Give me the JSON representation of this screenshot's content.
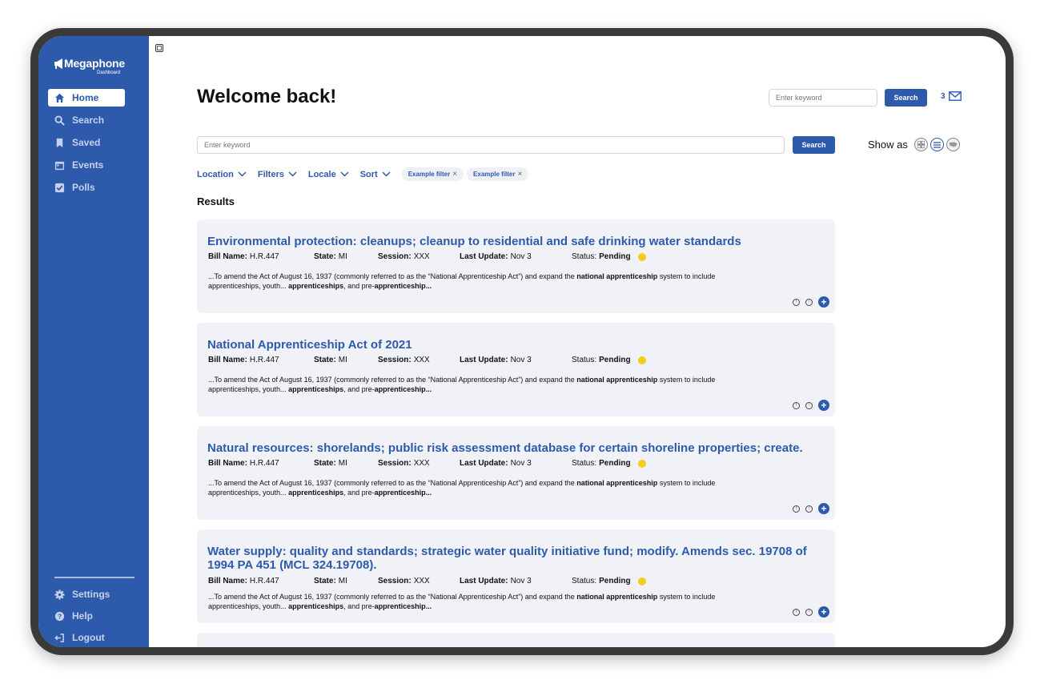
{
  "brand": {
    "name": "Megaphone",
    "subtitle": "Dashboard"
  },
  "sidebar": {
    "items": [
      {
        "label": "Home",
        "icon": "home-icon",
        "active": true
      },
      {
        "label": "Search",
        "icon": "search-icon"
      },
      {
        "label": "Saved",
        "icon": "bookmark-icon"
      },
      {
        "label": "Events",
        "icon": "calendar-icon"
      },
      {
        "label": "Polls",
        "icon": "checkbox-icon"
      }
    ],
    "bottom": [
      {
        "label": "Settings",
        "icon": "gear-icon"
      },
      {
        "label": "Help",
        "icon": "help-icon"
      },
      {
        "label": "Logout",
        "icon": "logout-icon"
      }
    ]
  },
  "header": {
    "title": "Welcome back!",
    "search_placeholder": "Enter keyword",
    "search_button": "Search",
    "message_count": "3"
  },
  "main_search": {
    "placeholder": "Enter keyword",
    "button": "Search"
  },
  "view": {
    "label": "Show as",
    "options": [
      "grid-view-icon",
      "list-view-icon",
      "map-view-icon"
    ],
    "active": "list-view-icon"
  },
  "filters": {
    "dropdowns": [
      "Location",
      "Filters",
      "Locale",
      "Sort"
    ],
    "chips": [
      "Example filter",
      "Example filter"
    ]
  },
  "results": {
    "heading": "Results",
    "labels": {
      "bill": "Bill Name:",
      "state": "State:",
      "session": "Session:",
      "update": "Last Update:",
      "status": "Status:"
    },
    "excerpt": {
      "p1": "...To amend the Act of August 16, 1937 (commonly referred to as the “National Apprenticeship Act”) and expand the ",
      "b1": "national apprenticeship",
      "p2": " system to include apprenticeships, youth... ",
      "b2": "apprenticeships",
      "p3": ", and pre-",
      "b3": "apprenticeship..."
    },
    "items": [
      {
        "title": "Environmental protection: cleanups; cleanup to residential and safe drinking water standards",
        "bill": "H.R.447",
        "state": "MI",
        "session": "XXX",
        "update": "Nov 3",
        "status": "Pending"
      },
      {
        "title": "National Apprenticeship Act of 2021",
        "bill": "H.R.447",
        "state": "MI",
        "session": "XXX",
        "update": "Nov 3",
        "status": "Pending"
      },
      {
        "title": "Natural resources: shorelands; public risk assessment database for certain shoreline properties; create.",
        "bill": "H.R.447",
        "state": "MI",
        "session": "XXX",
        "update": "Nov 3",
        "status": "Pending"
      },
      {
        "title": "Water supply: quality and standards; strategic water quality initiative fund; modify. Amends sec. 19708 of 1994 PA 451 (MCL 324.19708).",
        "bill": "H.R.447",
        "state": "MI",
        "session": "XXX",
        "update": "Nov 3",
        "status": "Pending"
      }
    ]
  },
  "colors": {
    "primary": "#2e5aab",
    "card": "#f1f2f7",
    "pending": "#f3cd1c"
  }
}
